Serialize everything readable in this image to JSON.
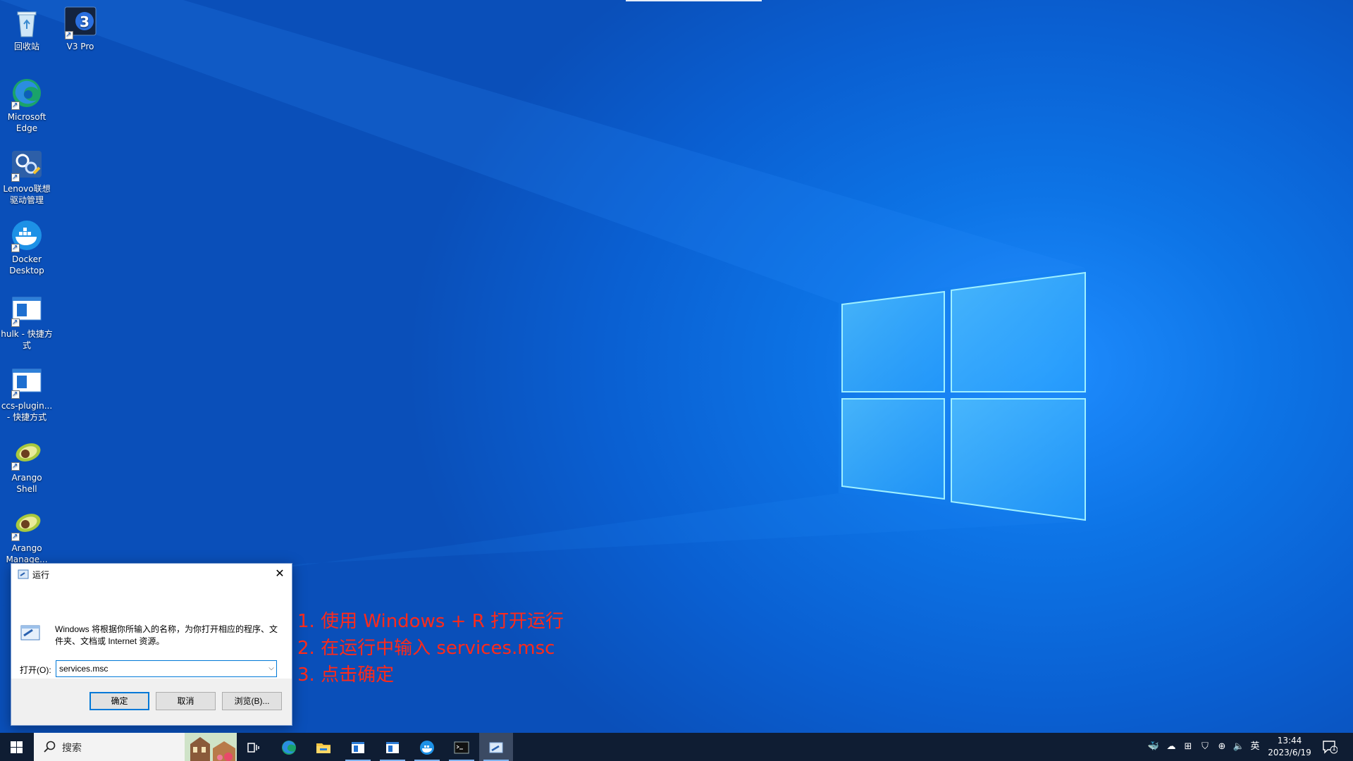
{
  "desktop": {
    "icons": [
      {
        "label": "回收站"
      },
      {
        "label": "V3 Pro"
      },
      {
        "label": "Microsoft Edge"
      },
      {
        "label": "Lenovo联想驱动管理"
      },
      {
        "label": "Docker Desktop"
      },
      {
        "label": "hulk - 快捷方式"
      },
      {
        "label": "ccs-plugin... - 快捷方式"
      },
      {
        "label": "Arango Shell"
      },
      {
        "label": "Arango Manage..."
      }
    ],
    "v3_badge": "3"
  },
  "run_dialog": {
    "title": "运行",
    "close_glyph": "✕",
    "description": "Windows 将根据你所输入的名称，为你打开相应的程序、文件夹、文档或 Internet 资源。",
    "open_label": "打开(O):",
    "open_value": "services.msc",
    "ok_label": "确定",
    "cancel_label": "取消",
    "browse_label": "浏览(B)..."
  },
  "annotations": [
    "1. 使用 Windows + R 打开运行",
    "2. 在运行中输入 services.msc",
    "3. 点击确定"
  ],
  "taskbar": {
    "search_placeholder": "搜索",
    "ime": "英",
    "time": "13:44",
    "date": "2023/6/19",
    "notification_count": "1"
  },
  "colors": {
    "annotation": "#ff2a1a",
    "taskbar": "#0f1d33",
    "accent": "#0078d7"
  }
}
